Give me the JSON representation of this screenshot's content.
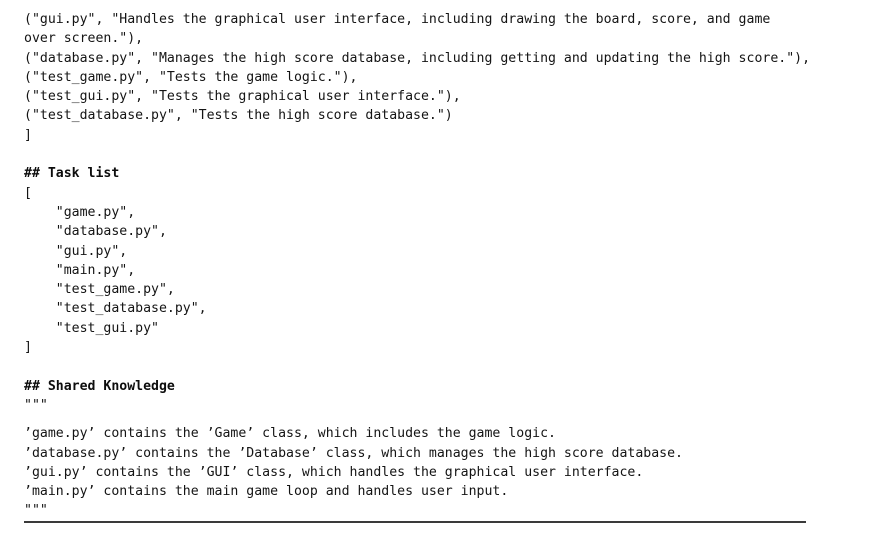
{
  "document": {
    "file_spec_tail": {
      "lines": [
        "(\"gui.py\", \"Handles the graphical user interface, including drawing the board, score, and game",
        "over screen.\"),",
        "(\"database.py\", \"Manages the high score database, including getting and updating the high score.\"),",
        "(\"test_game.py\", \"Tests the game logic.\"),",
        "(\"test_gui.py\", \"Tests the graphical user interface.\"),",
        "(\"test_database.py\", \"Tests the high score database.\")",
        "]"
      ],
      "text": "(\"gui.py\", \"Handles the graphical user interface, including drawing the board, score, and game\nover screen.\"),\n(\"database.py\", \"Manages the high score database, including getting and updating the high score.\"),\n(\"test_game.py\", \"Tests the game logic.\"),\n(\"test_gui.py\", \"Tests the graphical user interface.\"),\n(\"test_database.py\", \"Tests the high score database.\")\n]"
    },
    "task_list": {
      "heading": "## Task list",
      "open_bracket": "[",
      "close_bracket": "]",
      "items": [
        "\"game.py\",",
        "\"database.py\",",
        "\"gui.py\",",
        "\"main.py\",",
        "\"test_game.py\",",
        "\"test_database.py\",",
        "\"test_gui.py\""
      ],
      "text": "[\n    \"game.py\",\n    \"database.py\",\n    \"gui.py\",\n    \"main.py\",\n    \"test_game.py\",\n    \"test_database.py\",\n    \"test_gui.py\"\n]"
    },
    "shared_knowledge": {
      "heading": "## Shared Knowledge",
      "fence_open": "\"\"\"",
      "fence_close": "\"\"\"",
      "lines": [
        "’game.py’ contains the ’Game’ class, which includes the game logic.",
        "’database.py’ contains the ’Database’ class, which manages the high score database.",
        "’gui.py’ contains the ’GUI’ class, which handles the graphical user interface.",
        "’main.py’ contains the main game loop and handles user input."
      ],
      "body_text": "’game.py’ contains the ’Game’ class, which includes the game logic.\n’database.py’ contains the ’Database’ class, which manages the high score database.\n’gui.py’ contains the ’GUI’ class, which handles the graphical user interface.\n’main.py’ contains the main game loop and handles user input."
    },
    "divider": {
      "label": "horizontal-rule"
    }
  },
  "colors": {
    "background": "#ffffff",
    "text": "#141414",
    "rule": "#3a3a3a"
  }
}
